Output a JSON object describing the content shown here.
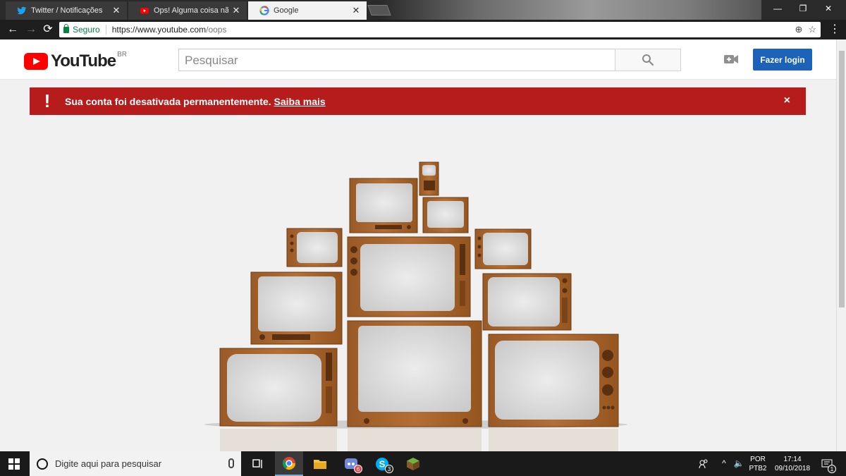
{
  "browser": {
    "tabs": [
      {
        "label": "Twitter / Notificações",
        "icon": "twitter-icon"
      },
      {
        "label": "Ops! Alguma coisa não d",
        "icon": "youtube-icon"
      },
      {
        "label": "Google",
        "icon": "google-icon"
      }
    ],
    "close_glyph": "✕",
    "secure_label": "Seguro",
    "url_base": "https://www.youtube.com",
    "url_path": "/oops"
  },
  "youtube": {
    "logo_text": "YouTube",
    "region": "BR",
    "search_placeholder": "Pesquisar",
    "login_label": "Fazer login"
  },
  "alert": {
    "icon": "!",
    "message": "Sua conta foi desativada permanentemente.",
    "link": "Saiba mais",
    "close": "×",
    "color": "#b61c1c"
  },
  "taskbar": {
    "search_placeholder": "Digite aqui para pesquisar",
    "apps": [
      {
        "name": "task-view"
      },
      {
        "name": "chrome",
        "active": true
      },
      {
        "name": "file-explorer"
      },
      {
        "name": "discord",
        "badge": "6"
      },
      {
        "name": "skype",
        "badge": "3"
      },
      {
        "name": "minecraft"
      }
    ],
    "language": "POR",
    "layout": "PTB2",
    "time": "17:14",
    "date": "09/10/2018",
    "notifications": "1"
  }
}
